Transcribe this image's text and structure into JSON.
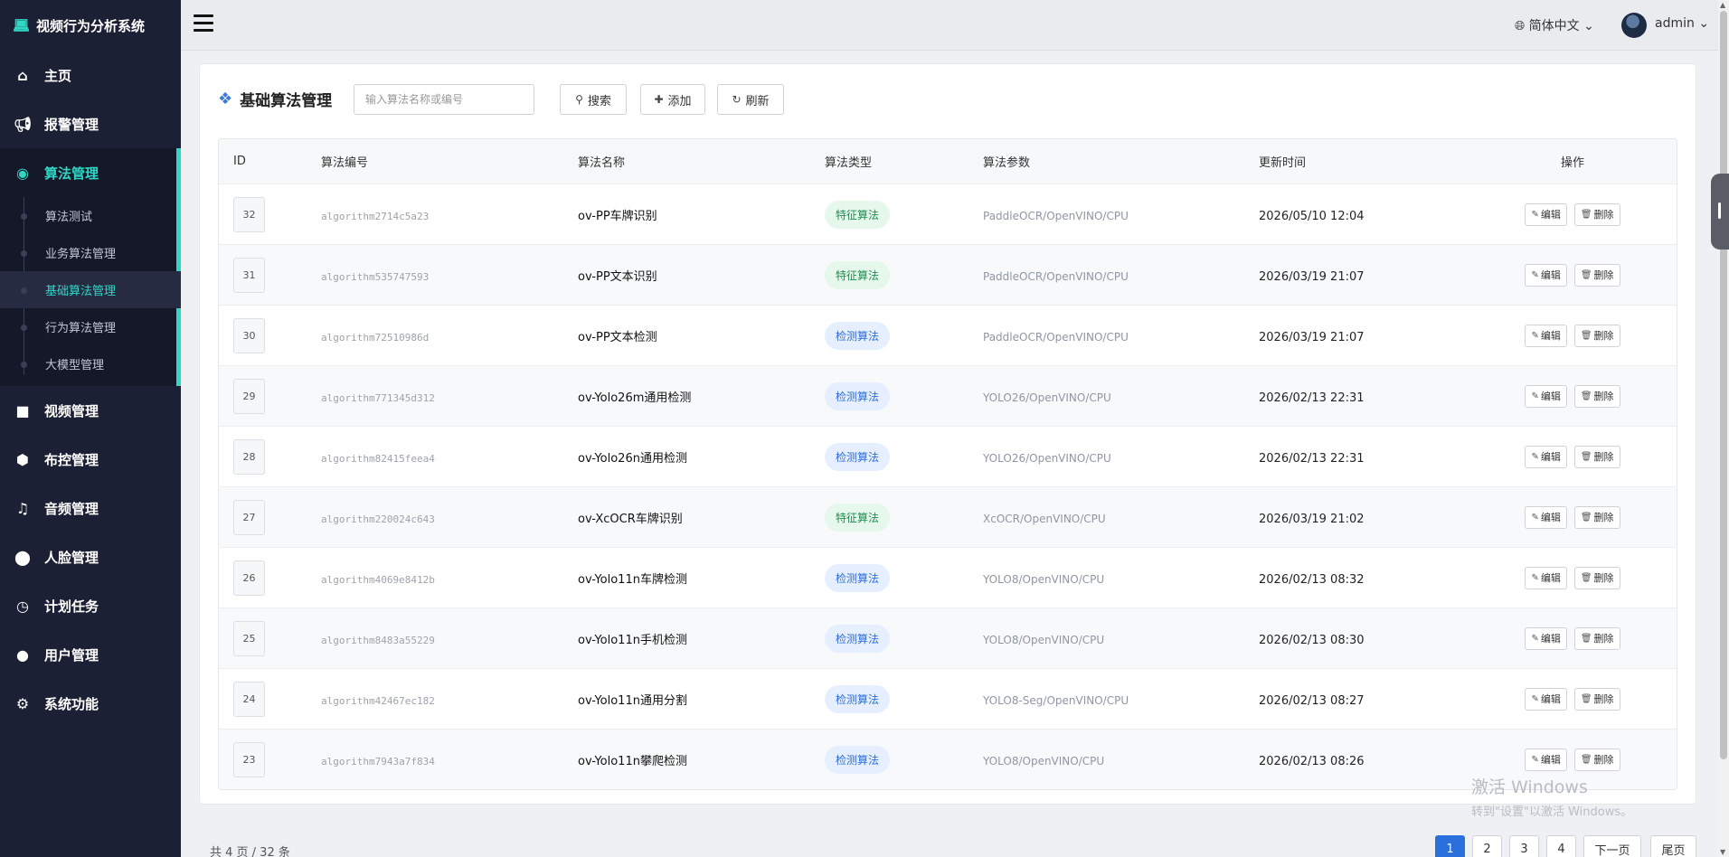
{
  "app": {
    "brand": "视频行为分析系统",
    "brand_icon": "laptop-icon"
  },
  "sidebar": {
    "items": [
      {
        "label": "主页",
        "icon": "home-icon"
      },
      {
        "label": "报警管理",
        "icon": "bullhorn-icon"
      },
      {
        "label": "算法管理",
        "icon": "eye-icon",
        "active": true,
        "children": [
          {
            "label": "算法测试"
          },
          {
            "label": "业务算法管理"
          },
          {
            "label": "基础算法管理",
            "active": true
          },
          {
            "label": "行为算法管理"
          },
          {
            "label": "大模型管理"
          }
        ]
      },
      {
        "label": "视频管理",
        "icon": "video-camera-icon"
      },
      {
        "label": "布控管理",
        "icon": "cube-icon"
      },
      {
        "label": "音频管理",
        "icon": "music-icon"
      },
      {
        "label": "人脸管理",
        "icon": "user-plus-icon"
      },
      {
        "label": "计划任务",
        "icon": "clock-icon"
      },
      {
        "label": "用户管理",
        "icon": "user-icon"
      },
      {
        "label": "系统功能",
        "icon": "gear-icon"
      }
    ],
    "accent_color": "#2fd8c5"
  },
  "topbar": {
    "language": "简体中文",
    "user": "admin"
  },
  "page": {
    "title": "基础算法管理",
    "title_icon": "cubes-icon",
    "search_placeholder": "输入算法名称或编号",
    "search_button": "搜索",
    "add_button": "添加",
    "refresh_button": "刷新"
  },
  "table": {
    "columns": [
      "ID",
      "算法编号",
      "算法名称",
      "算法类型",
      "算法参数",
      "更新时间",
      "操作"
    ],
    "edit_label": "编辑",
    "delete_label": "删除",
    "rows": [
      {
        "id": "32",
        "code": "algorithm2714c5a23",
        "name": "ov-PP车牌识别",
        "type": "特征算法",
        "type_kind": "feat",
        "param": "PaddleOCR/OpenVINO/CPU",
        "time": "2026/05/10 12:04"
      },
      {
        "id": "31",
        "code": "algorithm535747593",
        "name": "ov-PP文本识别",
        "type": "特征算法",
        "type_kind": "feat",
        "param": "PaddleOCR/OpenVINO/CPU",
        "time": "2026/03/19 21:07"
      },
      {
        "id": "30",
        "code": "algorithm72510986d",
        "name": "ov-PP文本检测",
        "type": "检测算法",
        "type_kind": "det",
        "param": "PaddleOCR/OpenVINO/CPU",
        "time": "2026/03/19 21:07"
      },
      {
        "id": "29",
        "code": "algorithm771345d312",
        "name": "ov-Yolo26m通用检测",
        "type": "检测算法",
        "type_kind": "det",
        "param": "YOLO26/OpenVINO/CPU",
        "time": "2026/02/13 22:31"
      },
      {
        "id": "28",
        "code": "algorithm82415feea4",
        "name": "ov-Yolo26n通用检测",
        "type": "检测算法",
        "type_kind": "det",
        "param": "YOLO26/OpenVINO/CPU",
        "time": "2026/02/13 22:31"
      },
      {
        "id": "27",
        "code": "algorithm220024c643",
        "name": "ov-XcOCR车牌识别",
        "type": "特征算法",
        "type_kind": "feat",
        "param": "XcOCR/OpenVINO/CPU",
        "time": "2026/03/19 21:02"
      },
      {
        "id": "26",
        "code": "algorithm4069e8412b",
        "name": "ov-Yolo11n车牌检测",
        "type": "检测算法",
        "type_kind": "det",
        "param": "YOLO8/OpenVINO/CPU",
        "time": "2026/02/13 08:32"
      },
      {
        "id": "25",
        "code": "algorithm8483a55229",
        "name": "ov-Yolo11n手机检测",
        "type": "检测算法",
        "type_kind": "det",
        "param": "YOLO8/OpenVINO/CPU",
        "time": "2026/02/13 08:30"
      },
      {
        "id": "24",
        "code": "algorithm42467ec182",
        "name": "ov-Yolo11n通用分割",
        "type": "检测算法",
        "type_kind": "det",
        "param": "YOLO8-Seg/OpenVINO/CPU",
        "time": "2026/02/13 08:27"
      },
      {
        "id": "23",
        "code": "algorithm7943a7f834",
        "name": "ov-Yolo11n攀爬检测",
        "type": "检测算法",
        "type_kind": "det",
        "param": "YOLO8/OpenVINO/CPU",
        "time": "2026/02/13 08:26"
      }
    ]
  },
  "pagination": {
    "summary": "共 4 页 / 32 条",
    "pages": [
      "1",
      "2",
      "3",
      "4"
    ],
    "current": "1",
    "next": "下一页",
    "last": "尾页"
  },
  "watermark": {
    "line1": "激活 Windows",
    "line2": "转到\"设置\"以激活 Windows。"
  }
}
